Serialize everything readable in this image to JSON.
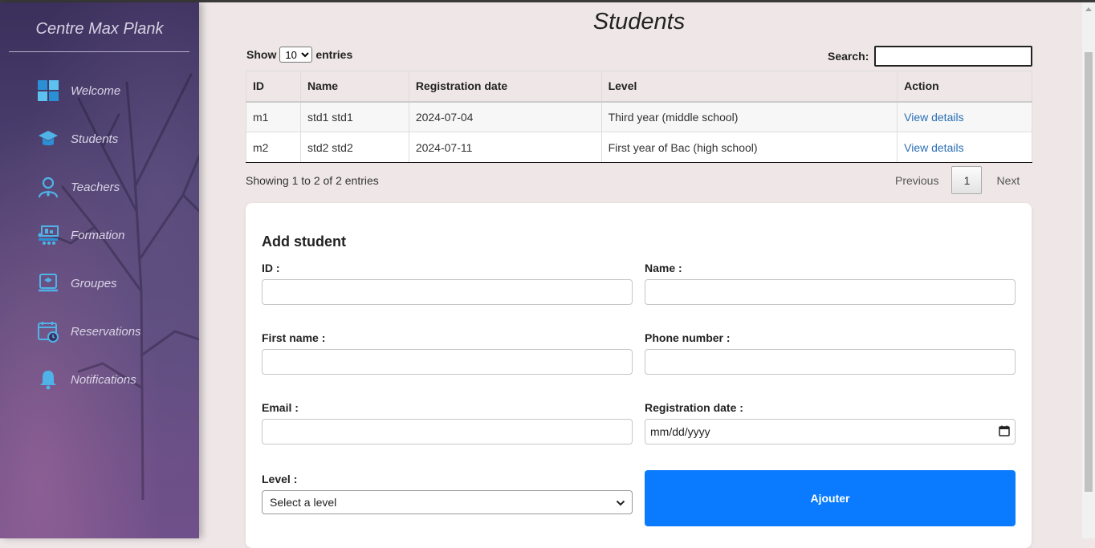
{
  "sidebar": {
    "brand": "Centre Max Plank",
    "items": [
      {
        "label": "Welcome",
        "icon": "welcome-grid-icon"
      },
      {
        "label": "Students",
        "icon": "graduation-cap-icon"
      },
      {
        "label": "Teachers",
        "icon": "teacher-icon"
      },
      {
        "label": "Formation",
        "icon": "formation-icon"
      },
      {
        "label": "Groupes",
        "icon": "groups-icon"
      },
      {
        "label": "Reservations",
        "icon": "calendar-clock-icon"
      },
      {
        "label": "Notifications",
        "icon": "bell-icon"
      }
    ]
  },
  "page": {
    "title": "Students"
  },
  "table_controls": {
    "show_label": "Show",
    "entries_value": "10",
    "entries_label": "entries",
    "search_label": "Search:",
    "search_value": ""
  },
  "table": {
    "headers": [
      "ID",
      "Name",
      "Registration date",
      "Level",
      "Action"
    ],
    "rows": [
      {
        "id": "m1",
        "name": "std1 std1",
        "date": "2024-07-04",
        "level": "Third year (middle school)",
        "action": "View details"
      },
      {
        "id": "m2",
        "name": "std2 std2",
        "date": "2024-07-11",
        "level": "First year of Bac (high school)",
        "action": "View details"
      }
    ]
  },
  "pagination": {
    "info": "Showing 1 to 2 of 2 entries",
    "previous": "Previous",
    "current_page": "1",
    "next": "Next"
  },
  "form": {
    "title": "Add student",
    "id_label": "ID :",
    "name_label": "Name :",
    "first_name_label": "First name :",
    "phone_label": "Phone number :",
    "email_label": "Email :",
    "registration_date_label": "Registration date :",
    "registration_date_placeholder": "mm/dd/yyyy",
    "level_label": "Level :",
    "level_value": "Select a level",
    "submit_label": "Ajouter"
  },
  "colors": {
    "accent": "#0a7bff",
    "link": "#2a6fb5",
    "page_bg": "#efe7e7",
    "sidebar_top": "#3b2f5c",
    "sidebar_bottom": "#70508a",
    "icon": "#4fb3e8"
  }
}
